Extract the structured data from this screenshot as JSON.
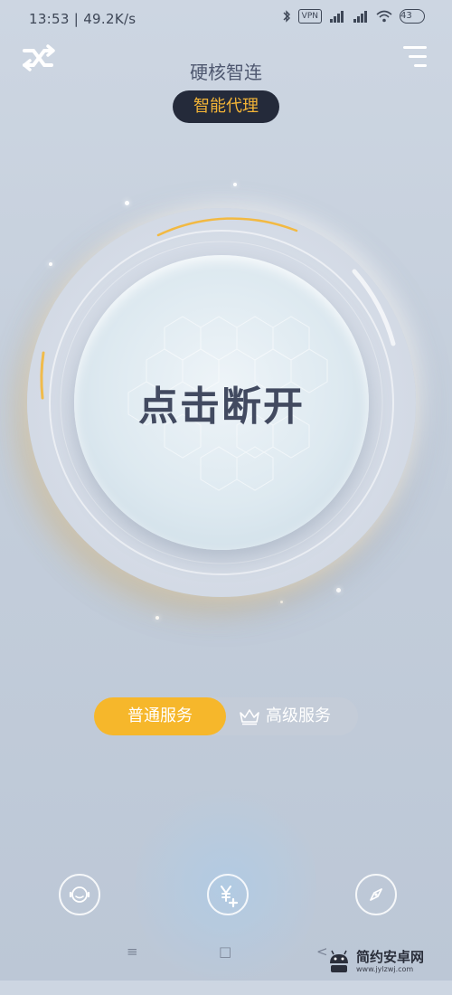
{
  "status_bar": {
    "time_speed": "13:53 | 49.2K/s",
    "vpn": "VPN",
    "signal1": "HD",
    "signal2": "HD",
    "battery": "43"
  },
  "header": {
    "title": "硬核智连",
    "mode": "智能代理"
  },
  "dial": {
    "label": "点击断开",
    "ring_color": "#f5b530"
  },
  "service": {
    "normal_label": "普通服务",
    "premium_label": "高级服务",
    "selected": "普通服务"
  },
  "actions": {
    "support": "support-icon",
    "recharge": "yen-plus-icon",
    "explore": "compass-icon"
  },
  "nav": {
    "menu": "≡",
    "home": "□",
    "back": "<"
  },
  "watermark": {
    "name": "简约安卓网",
    "url": "www.jylzwj.com"
  },
  "colors": {
    "accent": "#f6b72b",
    "pill_bg": "#242a3a",
    "pill_text": "#f3b437"
  }
}
